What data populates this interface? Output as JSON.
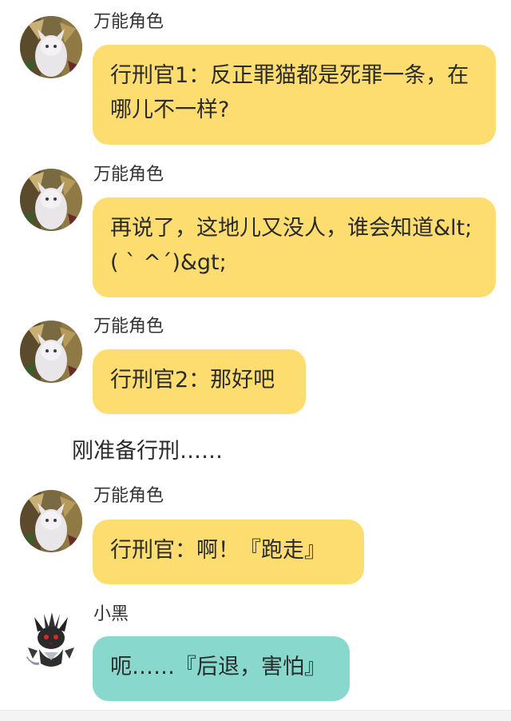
{
  "colors": {
    "bubble_yellow": "#fddd6f",
    "bubble_teal": "#88d8cd",
    "background": "#ffffff"
  },
  "messages": [
    {
      "sender": "万能角色",
      "avatar_icon": "character-portrait-avatar",
      "text": "行刑官1：反正罪猫都是死罪一条，在哪儿不一样?",
      "bubble_color": "yellow"
    },
    {
      "sender": "万能角色",
      "avatar_icon": "character-portrait-avatar",
      "text": "再说了，这地儿又没人，谁会知道&lt;( ` ^´)&gt;",
      "bubble_color": "yellow"
    },
    {
      "sender": "万能角色",
      "avatar_icon": "character-portrait-avatar",
      "text": "行刑官2：那好吧",
      "bubble_color": "yellow"
    },
    {
      "sender": "万能角色",
      "avatar_icon": "character-portrait-avatar",
      "text": "行刑官：啊！『跑走』",
      "bubble_color": "yellow"
    },
    {
      "sender": "小黑",
      "avatar_icon": "black-cat-avatar",
      "text": "呃……『后退，害怕』",
      "bubble_color": "teal"
    }
  ],
  "narration": "刚准备行刑……"
}
